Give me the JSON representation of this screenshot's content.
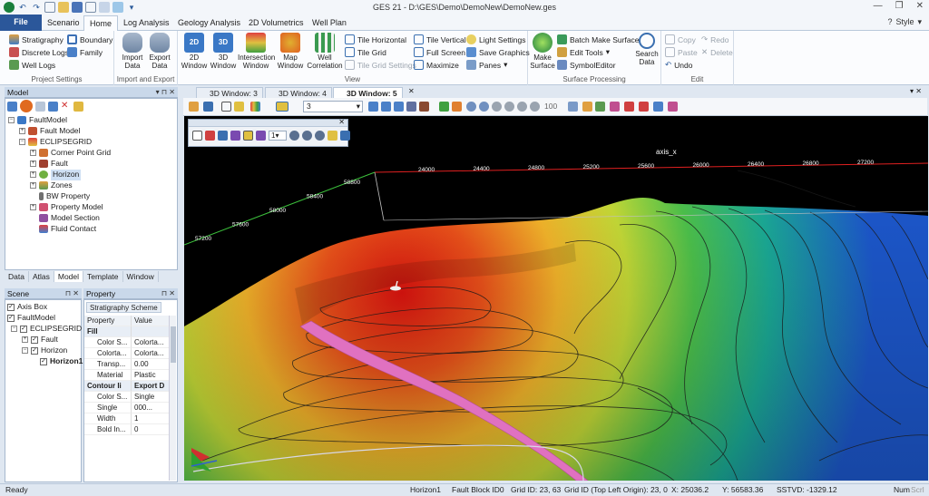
{
  "app": {
    "title": "GES 21 - D:\\GES\\Demo\\DemoNew\\DemoNew.ges",
    "style_label": "Style"
  },
  "tabs": [
    "File",
    "Scenario",
    "Home",
    "Log Analysis",
    "Geology Analysis",
    "2D Volumetrics",
    "Well Plan"
  ],
  "ribbon": {
    "project_settings": {
      "label": "Project Settings",
      "items": [
        "Stratigraphy",
        "Boundary",
        "Discrete Logs",
        "Family",
        "Well Logs"
      ]
    },
    "import_export": {
      "label": "Import and Export",
      "import": "Import\nData",
      "export": "Export\nData"
    },
    "view": {
      "label": "View",
      "big": [
        "2D\nWindow",
        "3D\nWindow",
        "Intersection\nWindow",
        "Map\nWindow",
        "Well\nCorrelation"
      ],
      "small": [
        "Tile Horizontal",
        "Tile Vertical",
        "Light Settings",
        "Tile Grid",
        "Full Screen",
        "Save Graphics",
        "Tile Grid Settings",
        "Maximize",
        "Panes"
      ]
    },
    "surface": {
      "label": "Surface Processing",
      "make": "Make\nSurface",
      "items": [
        "Batch Make Surface",
        "Edit Tools",
        "SymbolEditor"
      ],
      "search": "Search\nData"
    },
    "edit": {
      "label": "Edit",
      "items": [
        "Copy",
        "Redo",
        "Paste",
        "Delete",
        "Undo"
      ]
    }
  },
  "model_panel": {
    "title": "Model",
    "tree": [
      "FaultModel",
      "Fault Model",
      "ECLIPSEGRID",
      "Corner Point Grid",
      "Fault",
      "Horizon",
      "Zones",
      "BW Property",
      "Property Model",
      "Model Section",
      "Fluid Contact"
    ],
    "bottom_tabs": [
      "Data",
      "Atlas",
      "Model",
      "Template",
      "Window"
    ]
  },
  "scene_panel": {
    "title": "Scene",
    "tree": [
      "Axis Box",
      "FaultModel",
      "ECLIPSEGRID",
      "Fault",
      "Horizon",
      "Horizon1"
    ]
  },
  "property_panel": {
    "title": "Property",
    "tab": "Stratigraphy Scheme",
    "headers": [
      "Property",
      "Value"
    ],
    "rows": [
      {
        "k": "Fill",
        "v": "",
        "cat": true
      },
      {
        "k": "Color S...",
        "v": "Colorta..."
      },
      {
        "k": "Colorta...",
        "v": "Colorta..."
      },
      {
        "k": "Transp...",
        "v": "0.00"
      },
      {
        "k": "Material",
        "v": "Plastic"
      },
      {
        "k": "Contour li",
        "v": "Export D",
        "cat": true
      },
      {
        "k": "Color S...",
        "v": "Single"
      },
      {
        "k": "Single",
        "v": "000..."
      },
      {
        "k": "Width",
        "v": "1"
      },
      {
        "k": "Bold In...",
        "v": "0"
      }
    ]
  },
  "doc_tabs": [
    "3D Window: 3",
    "3D Window: 4",
    "3D Window: 5"
  ],
  "toolbar": {
    "level_value": "3",
    "zoom_value": "100",
    "sub_value": "1"
  },
  "viewport": {
    "axis_title": "axis_x",
    "x_ticks": [
      "24000",
      "24400",
      "24800",
      "25200",
      "25600",
      "26000",
      "26400",
      "26800",
      "27200"
    ],
    "y_ticks": [
      "57200",
      "57600",
      "58000",
      "58400",
      "58800"
    ]
  },
  "status": {
    "ready": "Ready",
    "horizon": "Horizon1",
    "fault_block": "Fault Block ID0",
    "grid_id": "Grid ID: 23, 63",
    "grid_id_tl": "Grid ID (Top Left Origin): 23, 0",
    "x": "X: 25036.2",
    "y": "Y: 56583.36",
    "sstvd": "SSTVD: -1329.12",
    "num": "Num",
    "scrl": "Scrl"
  },
  "colors": {
    "accent": "#2b579a",
    "panel_header": "#c9d8ea",
    "axis_red": "#e02020",
    "axis_green": "#3cc03c",
    "fault_pink": "#e071c0"
  }
}
